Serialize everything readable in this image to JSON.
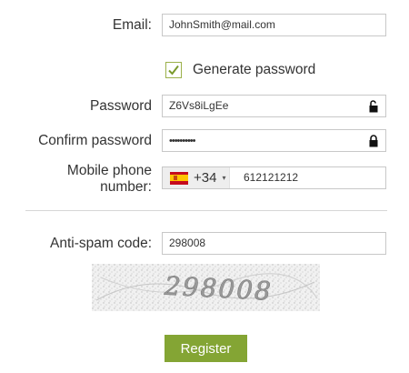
{
  "form": {
    "email": {
      "label": "Email:",
      "value": "JohnSmith@mail.com"
    },
    "generate_password": {
      "label": "Generate password",
      "checked": true
    },
    "password": {
      "label": "Password",
      "value": "Z6Vs8iLgEe",
      "lock_icon": "unlock-icon"
    },
    "confirm_password": {
      "label": "Confirm password",
      "value": "••••••••••",
      "lock_icon": "lock-icon"
    },
    "mobile": {
      "label_line1": "Mobile phone",
      "label_line2": "number:",
      "country_flag": "spain-flag-icon",
      "dial_code": "+34",
      "caret": "▾",
      "number": "612121212"
    },
    "antispam": {
      "label": "Anti-spam code:",
      "value": "298008",
      "captcha_text": "298008"
    },
    "register_button": "Register"
  },
  "colors": {
    "accent_green": "#84a534",
    "checkbox_border": "#9bb14a",
    "field_border": "#c8c8c8",
    "country_bg": "#eeeeee"
  }
}
